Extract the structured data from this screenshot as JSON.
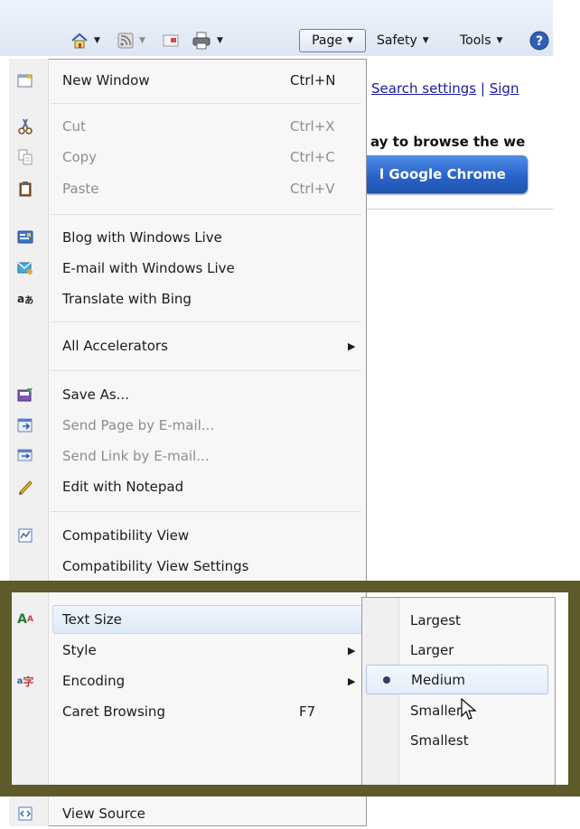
{
  "toolbar": {
    "page_label": "Page",
    "safety_label": "Safety",
    "tools_label": "Tools"
  },
  "page": {
    "search_settings": "Search settings",
    "sign_in": "Sign",
    "browse_text": "ay to browse the we",
    "chrome_button": "l Google Chrome"
  },
  "menu": {
    "items": [
      {
        "label": "New Window",
        "shortcut": "Ctrl+N",
        "icon": "new-window-icon"
      },
      {
        "label": "Cut",
        "shortcut": "Ctrl+X",
        "icon": "scissors-icon"
      },
      {
        "label": "Copy",
        "shortcut": "Ctrl+C",
        "icon": "copy-icon"
      },
      {
        "label": "Paste",
        "shortcut": "Ctrl+V",
        "icon": "clipboard-icon"
      },
      {
        "label": "Blog with Windows Live",
        "icon": "blog-icon"
      },
      {
        "label": "E-mail with Windows Live",
        "icon": "email-icon"
      },
      {
        "label": "Translate with Bing",
        "icon": "translate-icon"
      },
      {
        "label": "All Accelerators"
      },
      {
        "label": "Save As...",
        "icon": "save-icon"
      },
      {
        "label": "Send Page by E-mail...",
        "icon": "send-page-icon"
      },
      {
        "label": "Send Link by E-mail...",
        "icon": "send-link-icon"
      },
      {
        "label": "Edit with Notepad",
        "icon": "pencil-icon"
      },
      {
        "label": "Compatibility View",
        "icon": "compatibility-icon"
      },
      {
        "label": "Compatibility View Settings"
      },
      {
        "label": "Text Size",
        "icon": "text-size-icon"
      },
      {
        "label": "Style"
      },
      {
        "label": "Encoding",
        "icon": "encoding-icon"
      },
      {
        "label": "Caret Browsing",
        "shortcut": "F7"
      },
      {
        "label": "View Source",
        "icon": "view-source-icon"
      }
    ]
  },
  "text_size_submenu": {
    "options": [
      "Largest",
      "Larger",
      "Medium",
      "Smaller",
      "Smallest"
    ],
    "selected": "Medium"
  },
  "colors": {
    "frame": "#5f5a2a",
    "link": "#1a1aa6",
    "chrome_button": "#2a63c8"
  }
}
